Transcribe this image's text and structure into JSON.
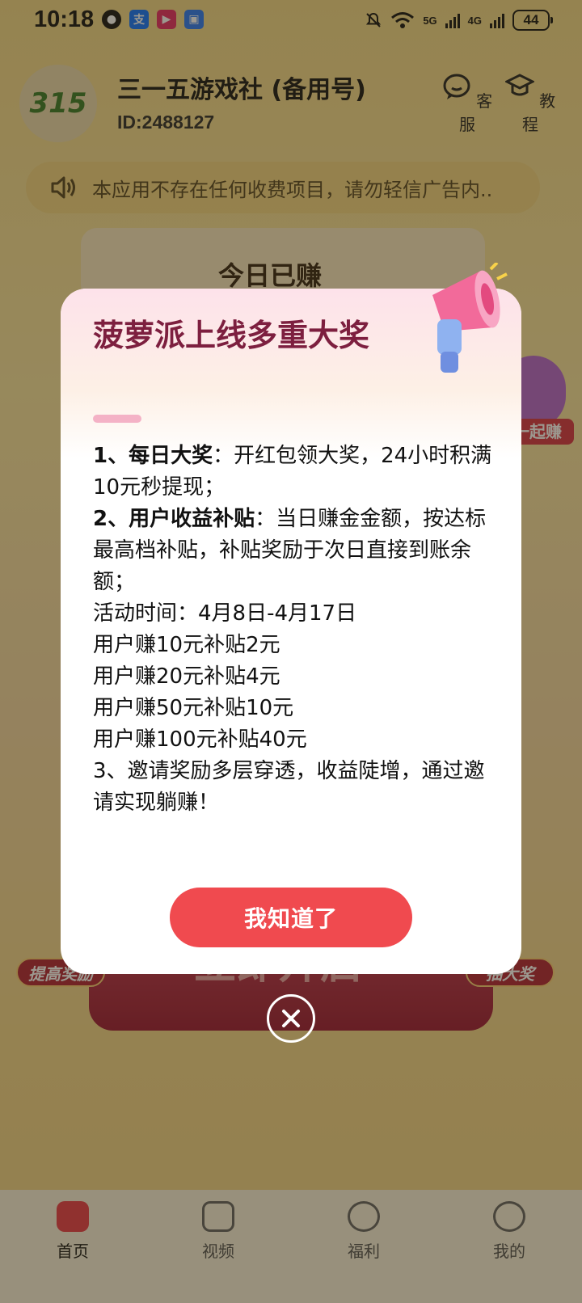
{
  "status_bar": {
    "time": "10:18",
    "network_5g": "5G",
    "network_4g": "4G",
    "battery": "44"
  },
  "header": {
    "logo_text": "315",
    "app_name": "三一五游戏社 (备用号)",
    "app_id": "ID:2488127",
    "service_label": "客服",
    "tutorial_label": "教程"
  },
  "notice": {
    "text": "本应用不存在任何收费项目，请勿轻信广告内.."
  },
  "earn_card": {
    "label": "今日已赚"
  },
  "side_badges": {
    "right_top": "一起赚",
    "left": "提高奖励",
    "right": "抽大奖"
  },
  "main_button": {
    "label": "立即开启"
  },
  "modal": {
    "title": "菠萝派上线多重大奖",
    "item1_head": "1、每日大奖",
    "item1_body": "：开红包领大奖，24小时积满10元秒提现；",
    "item2_head": "2、用户收益补贴",
    "item2_body": "：当日赚金金额，按达标最高档补贴，补贴奖励于次日直接到账余额；",
    "activity_time": "活动时间：4月8日-4月17日",
    "tiers": [
      "用户赚10元补贴2元",
      "用户赚20元补贴4元",
      "用户赚50元补贴10元",
      "用户赚100元补贴40元"
    ],
    "item3": "3、邀请奖励多层穿透，收益陡增，通过邀请实现躺赚！",
    "ok_label": "我知道了"
  },
  "bottom_nav": {
    "items": [
      {
        "label": "首页"
      },
      {
        "label": "视频"
      },
      {
        "label": "福利"
      },
      {
        "label": "我的"
      }
    ]
  },
  "colors": {
    "accent_red": "#f04a4f",
    "title_purple": "#7d1f3f"
  }
}
